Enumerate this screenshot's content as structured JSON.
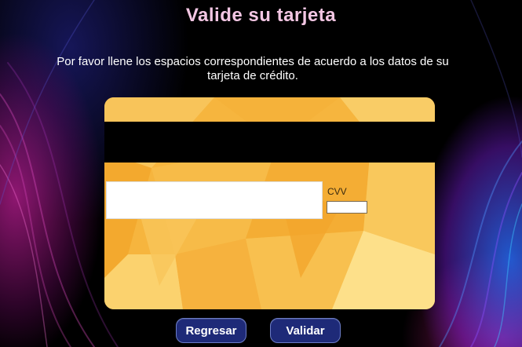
{
  "page": {
    "title": "Valide su tarjeta",
    "instructions": "Por favor llene los espacios correspondientes de acuerdo a los datos de su tarjeta de crédito."
  },
  "card": {
    "cvv_label": "CVV",
    "cvv_value": "",
    "signature_value": ""
  },
  "buttons": {
    "back_label": "Regresar",
    "validate_label": "Validar"
  },
  "colors": {
    "title": "#f3c6e3",
    "card_base": "#f6b53e",
    "button_bg": "#1e2a78"
  }
}
